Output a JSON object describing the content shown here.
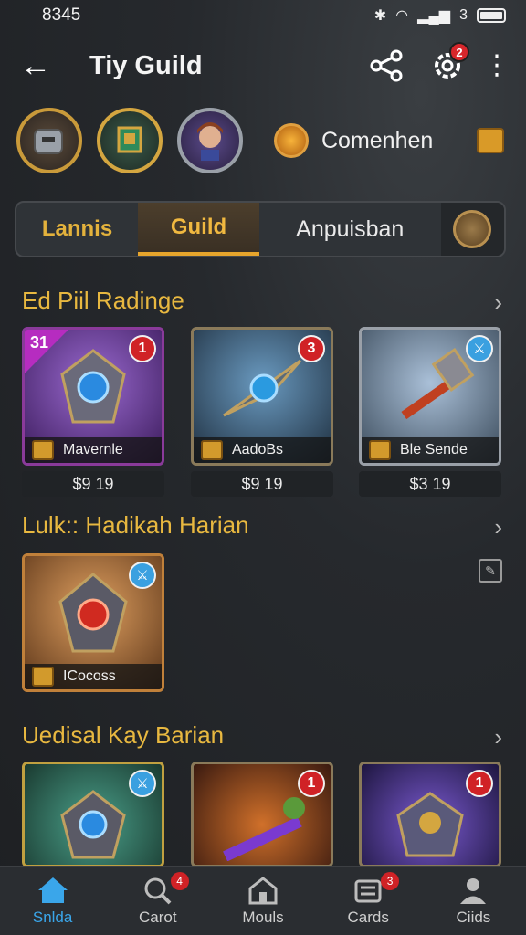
{
  "status": {
    "time": "8345",
    "signal_label": "3"
  },
  "header": {
    "title": "Tiy Guild",
    "settings_badge": "2"
  },
  "profile": {
    "currency_label": "Comenhen"
  },
  "tabs": [
    {
      "label": "Lannis"
    },
    {
      "label": "Guild"
    },
    {
      "label": "Anpuisban"
    }
  ],
  "sections": [
    {
      "title": "Ed Piil Radinge",
      "items": [
        {
          "name": "Mavernle",
          "price": "$9 19",
          "badge": "1",
          "corner": "31",
          "color": "#b62cc0"
        },
        {
          "name": "AadoBs",
          "price": "$9 19",
          "badge": "3",
          "color": "#3a6a8a"
        },
        {
          "name": "Ble Sende",
          "price": "$3 19",
          "badge": "",
          "color": "#5a6a80"
        }
      ]
    },
    {
      "title": "Lulk:: Hadikah Harian",
      "items": [
        {
          "name": "ICocoss",
          "badge": "",
          "color": "#8a5a2a"
        }
      ]
    },
    {
      "title": "Uedisal Kay Barian",
      "items": [
        {
          "name": "",
          "badge": "",
          "color": "#2a7a5a"
        },
        {
          "name": "",
          "badge": "1",
          "color": "#8a3a1a"
        },
        {
          "name": "",
          "badge": "1",
          "color": "#4a3a8a"
        }
      ]
    }
  ],
  "nav": [
    {
      "label": "Snlda",
      "badge": ""
    },
    {
      "label": "Carot",
      "badge": "4"
    },
    {
      "label": "Mouls",
      "badge": ""
    },
    {
      "label": "Cards",
      "badge": "3"
    },
    {
      "label": "Ciids",
      "badge": ""
    }
  ]
}
